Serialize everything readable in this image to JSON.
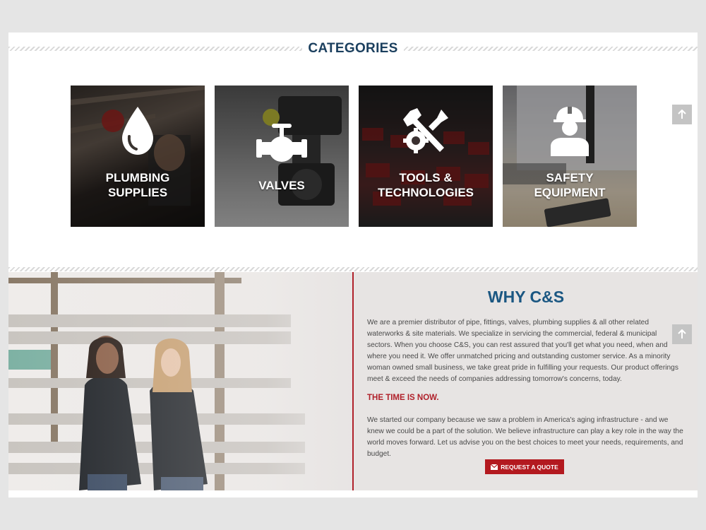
{
  "categories": {
    "title": "CATEGORIES",
    "items": [
      {
        "label_line1": "PLUMBING",
        "label_line2": "SUPPLIES",
        "icon": "water-drop-icon"
      },
      {
        "label_line1": "VALVES",
        "label_line2": "",
        "icon": "valve-icon"
      },
      {
        "label_line1": "TOOLS &",
        "label_line2": "TECHNOLOGIES",
        "icon": "tools-icon"
      },
      {
        "label_line1": "SAFETY",
        "label_line2": "EQUIPMENT",
        "icon": "hard-hat-worker-icon"
      }
    ]
  },
  "why": {
    "title": "WHY C&S",
    "paragraph1": "We are a premier distributor of pipe, fittings, valves, plumbing supplies & all other related waterworks & site materials. We specialize in servicing the commercial, federal & municipal sectors. When you choose C&S, you can rest assured that you'll get what you need, when and where you need it. We offer unmatched pricing and outstanding customer service. As a minority woman owned small business, we take great pride in fulfilling your requests. Our product offerings meet & exceed the needs of companies addressing tomorrow's concerns, today.",
    "subtitle": "THE TIME IS NOW.",
    "paragraph2": "We started our company because we saw a problem in America's aging infrastructure - and we knew we could be a part of the solution. We believe infrastructure can play a key role in the way the world moves forward. Let us advise you on the best choices to meet your needs, requirements, and budget.",
    "button_label": "REQUEST A QUOTE",
    "button_icon": "envelope-icon"
  },
  "colors": {
    "brand_blue": "#1b3f5e",
    "accent_red": "#b3191f"
  }
}
